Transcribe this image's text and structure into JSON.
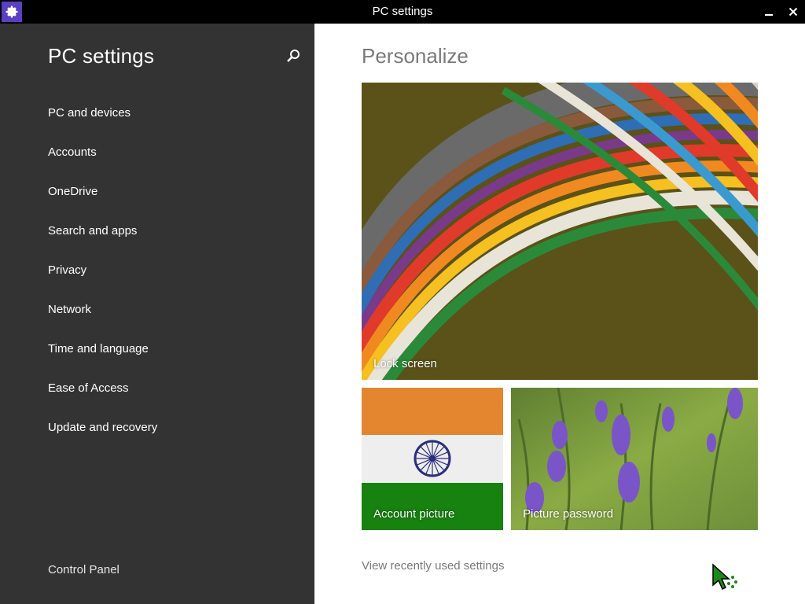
{
  "window": {
    "title": "PC settings",
    "app_icon": "gear-icon",
    "minimize_icon": "minimize-icon",
    "close_icon": "close-icon",
    "accent_color": "#5b3fc4"
  },
  "sidebar": {
    "title": "PC settings",
    "search_icon": "search-icon",
    "items": [
      {
        "label": "PC and devices"
      },
      {
        "label": "Accounts"
      },
      {
        "label": "OneDrive"
      },
      {
        "label": "Search and apps"
      },
      {
        "label": "Privacy"
      },
      {
        "label": "Network"
      },
      {
        "label": "Time and language"
      },
      {
        "label": "Ease of Access"
      },
      {
        "label": "Update and recovery"
      }
    ],
    "footer_link": "Control Panel",
    "background": "#333333"
  },
  "main": {
    "title": "Personalize",
    "tiles": {
      "lock_screen": "Lock screen",
      "account_picture": "Account picture",
      "picture_password": "Picture password"
    },
    "recent_link": "View recently used settings"
  }
}
